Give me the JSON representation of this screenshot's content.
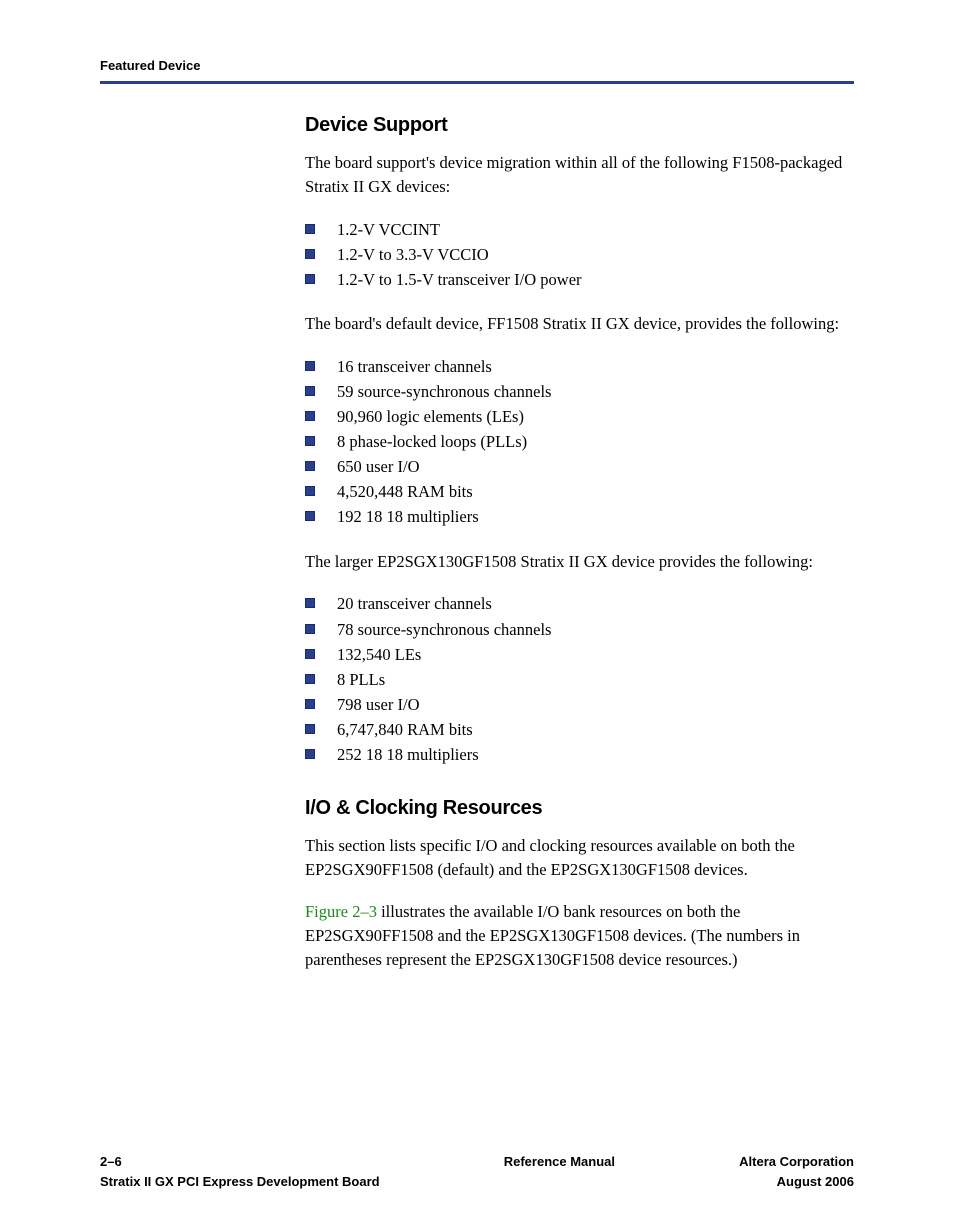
{
  "running_header": "Featured Device",
  "sections": {
    "device_support": {
      "title": "Device Support",
      "intro": "The board support's device migration within all of the following F1508-packaged Stratix II GX devices:",
      "list1": [
        "1.2-V VCCINT",
        "1.2-V to 3.3-V VCCIO",
        "1.2-V to 1.5-V transceiver I/O power"
      ],
      "para2": "The board's default device, FF1508 Stratix II GX device, provides the following:",
      "list2": [
        "16 transceiver channels",
        "59 source-synchronous channels",
        "90,960 logic elements (LEs)",
        "8 phase-locked loops (PLLs)",
        "650 user I/O",
        "4,520,448 RAM bits",
        "192 18  18 multipliers"
      ],
      "para3": "The larger EP2SGX130GF1508 Stratix II GX device provides the following:",
      "list3": [
        "20 transceiver channels",
        "78 source-synchronous channels",
        "132,540 LEs",
        "8 PLLs",
        "798 user I/O",
        "6,747,840 RAM bits",
        "252 18  18 multipliers"
      ]
    },
    "io_clocking": {
      "title": "I/O & Clocking Resources",
      "para1": "This section lists specific I/O and clocking resources available on both the EP2SGX90FF1508 (default) and the EP2SGX130GF1508 devices.",
      "figure_link": "Figure 2–3",
      "para2_rest": " illustrates the available I/O bank resources on both the EP2SGX90FF1508 and the EP2SGX130GF1508 devices. (The numbers in parentheses represent the EP2SGX130GF1508 device resources.)"
    }
  },
  "footer": {
    "page_num": "2–6",
    "doc_title": "Stratix II GX PCI Express Development Board",
    "center": "Reference Manual",
    "company": "Altera Corporation",
    "date": "August 2006"
  }
}
